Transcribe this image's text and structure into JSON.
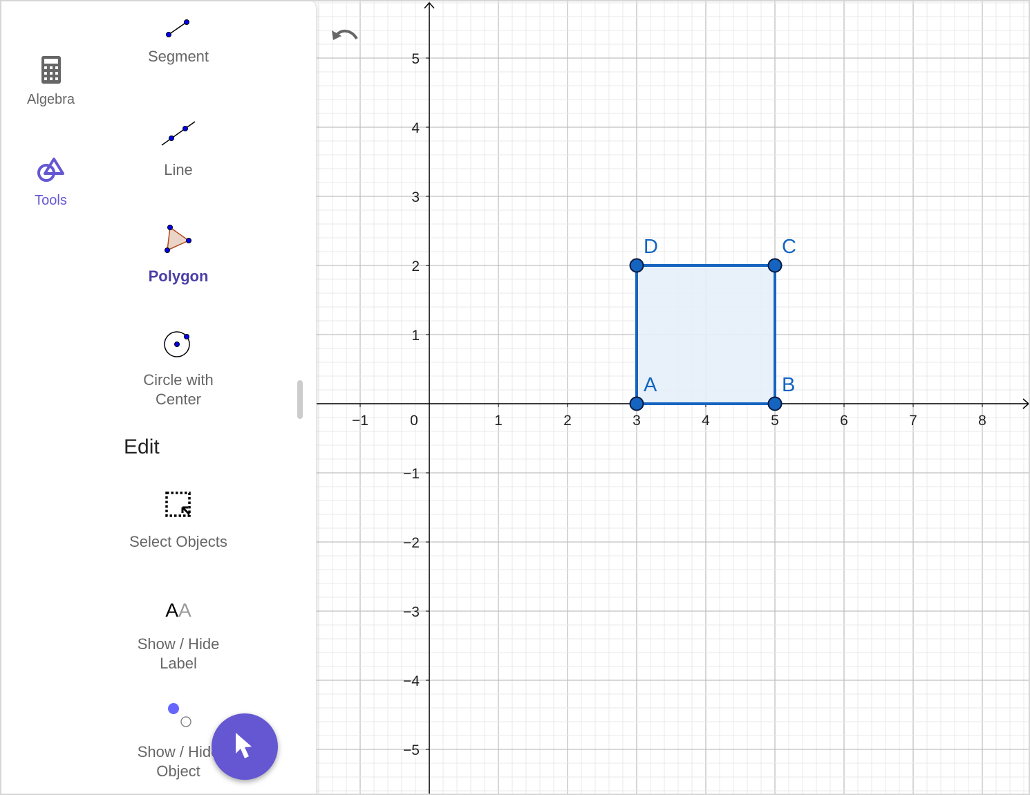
{
  "rail": {
    "items": [
      {
        "label": "Algebra",
        "icon": "calculator-icon",
        "active": false
      },
      {
        "label": "Tools",
        "icon": "tools-icon",
        "active": true
      }
    ]
  },
  "tools_panel": {
    "tools": [
      {
        "label": "Segment",
        "icon": "segment-icon"
      },
      {
        "label": "Line",
        "icon": "line-icon"
      },
      {
        "label": "Polygon",
        "icon": "polygon-icon",
        "active": true
      },
      {
        "label": "Circle with Center",
        "icon": "circle-with-center-icon"
      }
    ],
    "edit_section": "Edit",
    "edit_tools": [
      {
        "label": "Select Objects",
        "icon": "select-objects-icon"
      },
      {
        "label": "Show / Hide Label",
        "icon": "show-hide-label-icon",
        "icon_text": "AA"
      },
      {
        "label": "Show / Hide Object",
        "icon": "show-hide-object-icon"
      }
    ]
  },
  "fab": {
    "icon": "cursor-arrow-icon"
  },
  "undo": {
    "icon": "undo-icon"
  },
  "graphics": {
    "x_ticks": [
      "−1",
      "0",
      "1",
      "2",
      "3",
      "4",
      "5",
      "6",
      "7",
      "8"
    ],
    "y_ticks": [
      "5",
      "4",
      "3",
      "2",
      "1",
      "−1",
      "−2",
      "−3",
      "−4",
      "−5"
    ],
    "polygon": {
      "points": [
        {
          "name": "A",
          "x": 3,
          "y": 0
        },
        {
          "name": "B",
          "x": 5,
          "y": 0
        },
        {
          "name": "C",
          "x": 5,
          "y": 2
        },
        {
          "name": "D",
          "x": 3,
          "y": 2
        }
      ],
      "stroke_color": "#1565c0",
      "fill_color": "#e6eef9"
    }
  },
  "colors": {
    "accent": "#6557d2",
    "point": "#1565c0"
  }
}
